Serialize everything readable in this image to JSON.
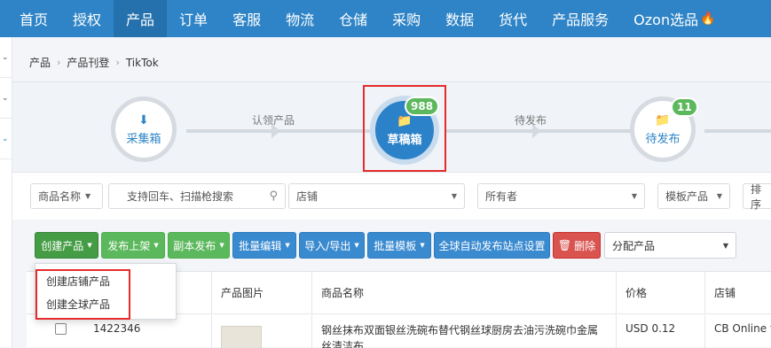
{
  "topnav": {
    "items": [
      "首页",
      "授权",
      "产品",
      "订单",
      "客服",
      "物流",
      "仓储",
      "采购",
      "数据",
      "货代",
      "产品服务",
      "Ozon选品"
    ],
    "active": "产品",
    "accent": "#2e84c6"
  },
  "breadcrumb": [
    "产品",
    "产品刊登",
    "TikTok"
  ],
  "steps": {
    "collect": {
      "label": "采集箱",
      "icon": "download-icon"
    },
    "transition1": "认领产品",
    "draft": {
      "label": "草稿箱",
      "badge": "988",
      "icon": "folder-icon"
    },
    "transition2": "待发布",
    "pending": {
      "label": "待发布",
      "badge": "11",
      "icon": "folder-icon"
    }
  },
  "filters": {
    "name_select": "商品名称",
    "search_placeholder": "支持回车、扫描枪搜索",
    "shop": "店铺",
    "owner": "所有者",
    "template": "模板产品",
    "sort": "排序"
  },
  "actions": {
    "create": "创建产品",
    "publish": "发布上架",
    "copy_publish": "副本发布",
    "bulk_edit": "批量编辑",
    "import_export": "导入/导出",
    "bulk_template": "批量模板",
    "auto_publish": "全球自动发布站点设置",
    "delete": "删除",
    "assign": "分配产品"
  },
  "dropdown": {
    "items": [
      "创建店铺产品",
      "创建全球产品"
    ]
  },
  "table": {
    "headers": [
      "产品图片",
      "商品名称",
      "价格",
      "店铺"
    ],
    "rows": [
      {
        "id": "1422346",
        "name": "钢丝抹布双面银丝洗碗布替代钢丝球厨房去油污洗碗巾金属丝清洁布",
        "price": "USD 0.12",
        "shop": "CB Online te"
      }
    ]
  }
}
